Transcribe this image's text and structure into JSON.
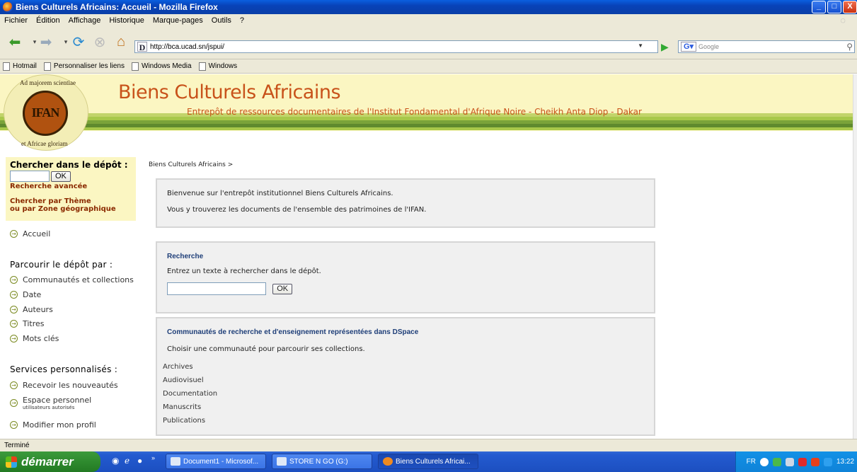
{
  "window": {
    "title": "Biens Culturels Africains: Accueil - Mozilla Firefox",
    "buttons": {
      "minimize": "_",
      "maximize": "□",
      "close": "X"
    }
  },
  "menu": [
    "Fichier",
    "Édition",
    "Affichage",
    "Historique",
    "Marque-pages",
    "Outils",
    "?"
  ],
  "toolbar": {
    "url": "http://bca.ucad.sn/jspui/",
    "search_placeholder": "Google"
  },
  "bookmarks": [
    "Hotmail",
    "Personnaliser les liens",
    "Windows Media",
    "Windows"
  ],
  "banner": {
    "title": "Biens Culturels Africains",
    "subtitle": "Entrepôt de ressources documentaires de l'Institut Fondamental d'Afrique Noire - Cheikh Anta Diop - Dakar",
    "logo_text": "IFAN",
    "logo_motto_top": "Ad majorem scientiae",
    "logo_motto_bottom": "et Africae gloriam"
  },
  "sidebar": {
    "search_heading": "Chercher dans le dépôt :",
    "search_button": "OK",
    "advanced_search": "Recherche avancée",
    "theme_search_line1": "Chercher par Thème",
    "theme_search_line2": "ou par Zone géographique",
    "home": "Accueil",
    "browse_heading": "Parcourir le dépôt par",
    "browse_colon": ":",
    "browse_items": [
      "Communautés et collections",
      "Date",
      "Auteurs",
      "Titres",
      "Mots clés"
    ],
    "services_heading": "Services personnalisés",
    "services_colon": ":",
    "services": {
      "alerts": "Recevoir les nouveautés",
      "personal": "Espace personnel",
      "personal_note": "utilisateurs autorisés",
      "profile": "Modifier mon profil"
    }
  },
  "main": {
    "breadcrumb": "Biens Culturels Africains >",
    "welcome_line1": "Bienvenue sur l'entrepôt institutionnel Biens Culturels Africains.",
    "welcome_line2": "Vous y trouverez les documents de l'ensemble des patrimoines de l'IFAN.",
    "search_title": "Recherche",
    "search_text": "Entrez un texte à rechercher dans le dépôt.",
    "search_button": "OK",
    "communities_title": "Communautés de recherche et d'enseignement représentées dans DSpace",
    "communities_text": "Choisir une communauté pour parcourir ses collections.",
    "communities": [
      "Archives",
      "Audiovisuel",
      "Documentation",
      "Manuscrits",
      "Publications"
    ]
  },
  "status": "Terminé",
  "taskbar": {
    "start": "démarrer",
    "tasks": [
      "Document1 - Microsof...",
      "STORE N GO (G:)",
      "Biens Culturels Africai..."
    ],
    "lang": "FR",
    "time": "13:22"
  },
  "colors": {
    "banner_bg": "#fbf6c2",
    "title_orange": "#c8521a",
    "stripes": [
      "#a8c84a",
      "#7aa33a",
      "#5f8a2e",
      "#c2d46a"
    ]
  }
}
